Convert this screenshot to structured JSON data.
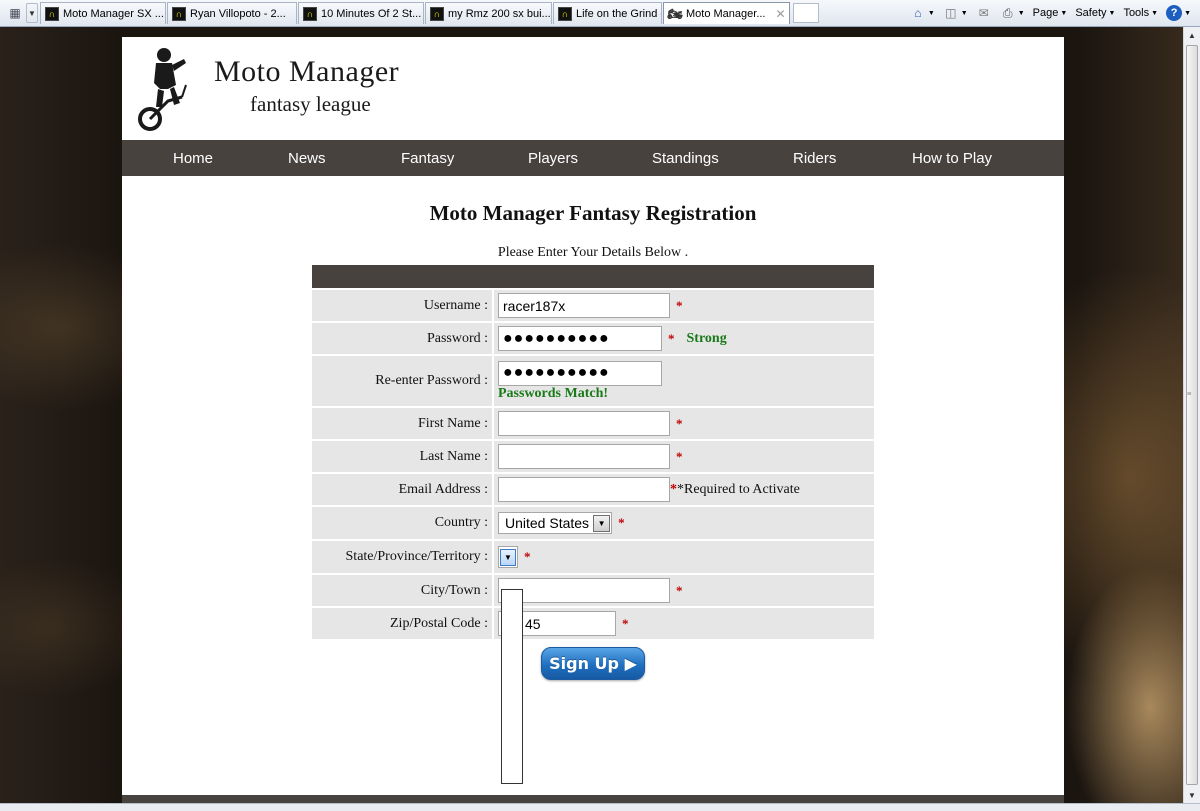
{
  "browser": {
    "tabs": [
      {
        "label": "Moto Manager SX ..."
      },
      {
        "label": "Ryan Villopoto - 2..."
      },
      {
        "label": "10 Minutes Of 2 St..."
      },
      {
        "label": "my Rmz 200 sx bui..."
      },
      {
        "label": "Life on the Grind -..."
      },
      {
        "label": "Moto Manager..."
      }
    ],
    "active_tab_index": 5,
    "commands": {
      "page": "Page",
      "safety": "Safety",
      "tools": "Tools"
    }
  },
  "site": {
    "title": "Moto Manager",
    "subtitle": "fantasy league",
    "nav": [
      "Home",
      "News",
      "Fantasy",
      "Players",
      "Standings",
      "Riders",
      "How to Play"
    ]
  },
  "registration": {
    "heading": "Moto Manager Fantasy Registration",
    "instructions": "Please Enter Your Details Below .",
    "required_mark": "*",
    "fields": {
      "username": {
        "label": "Username :",
        "value": "racer187x"
      },
      "password": {
        "label": "Password :",
        "value": "●●●●●●●●●●",
        "strength": "Strong"
      },
      "reenter_password": {
        "label": "Re-enter Password :",
        "value": "●●●●●●●●●●",
        "match_message": "Passwords Match!"
      },
      "first_name": {
        "label": "First Name :",
        "value": ""
      },
      "last_name": {
        "label": "Last Name :",
        "value": ""
      },
      "email": {
        "label": "Email Address :",
        "value": "",
        "note": "*Required to Activate"
      },
      "country": {
        "label": "Country :",
        "selected": "United States"
      },
      "state": {
        "label": "State/Province/Territory :",
        "selected": ""
      },
      "city": {
        "label": "City/Town :",
        "value": ""
      },
      "zip": {
        "label": "Zip/Postal Code :",
        "value": "45"
      }
    },
    "submit_label": "Sign Up ▶"
  }
}
